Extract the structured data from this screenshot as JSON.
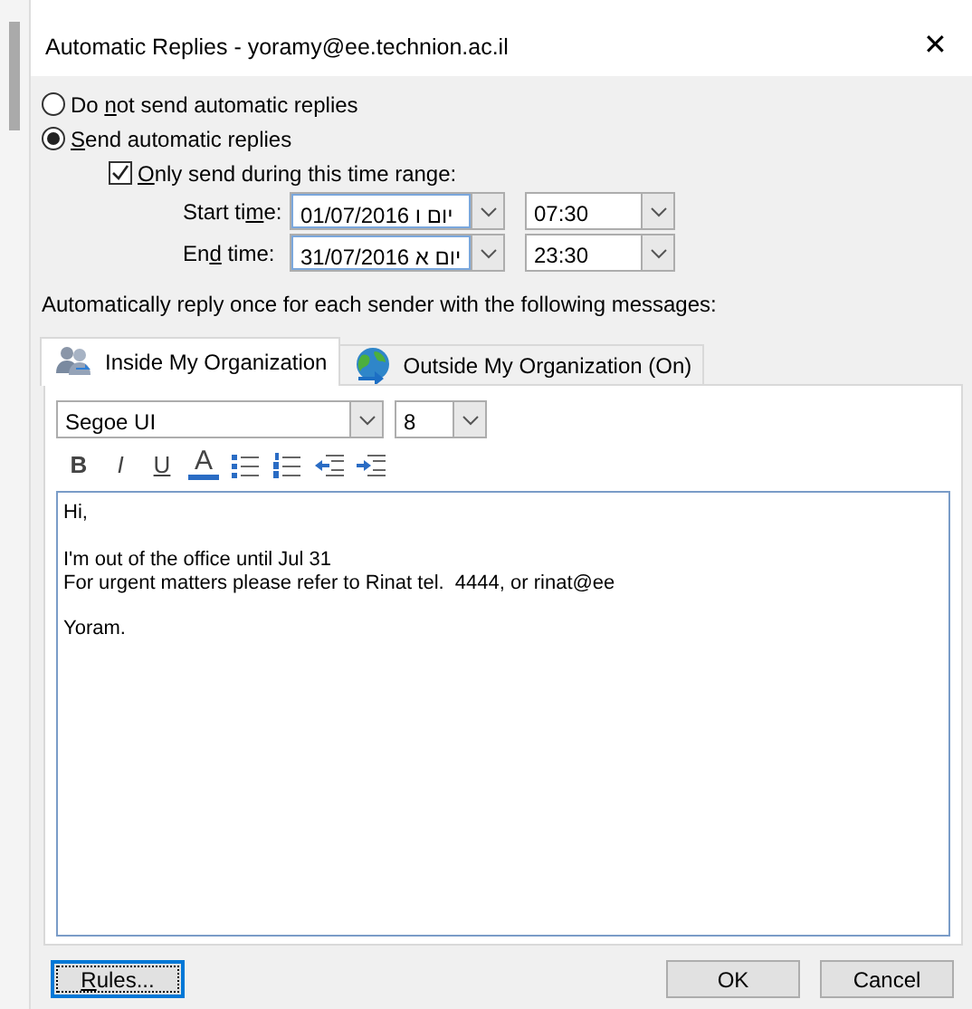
{
  "window": {
    "title": "Automatic Replies - yoramy@ee.technion.ac.il",
    "close": "✕"
  },
  "modes": [
    {
      "label": {
        "pre": "Do ",
        "key": "n",
        "post": "ot send automatic replies"
      },
      "selected": false
    },
    {
      "label": {
        "key": "S",
        "post": "end automatic replies"
      },
      "selected": true
    }
  ],
  "time_range": {
    "label": {
      "key": "O",
      "post": "nly send during this time range:"
    },
    "checked": true
  },
  "times": [
    {
      "label": {
        "pre": "Start ti",
        "key": "m",
        "post": "e:"
      },
      "date": "01/07/2016 יום ו",
      "time": "07:30"
    },
    {
      "label": {
        "pre": "En",
        "key": "d",
        "post": " time:"
      },
      "date": "31/07/2016 יום א",
      "time": "23:30"
    }
  ],
  "messages_label": "Automatically reply once for each sender with the following messages:",
  "tabs": [
    {
      "label": "Inside My Organization",
      "kind": "people",
      "selected": true
    },
    {
      "label": "Outside My Organization (On)",
      "kind": "globe",
      "selected": false
    }
  ],
  "font": {
    "family": "Segoe UI",
    "size": "8"
  },
  "toolbar": [
    {
      "kind": "bold",
      "label": "B"
    },
    {
      "kind": "italic",
      "label": "I"
    },
    {
      "kind": "underline",
      "label": "U"
    },
    {
      "kind": "font-color",
      "label": "A"
    },
    {
      "kind": "bullets"
    },
    {
      "kind": "numbering"
    },
    {
      "kind": "outdent"
    },
    {
      "kind": "indent"
    }
  ],
  "message": "Hi,\n\nI'm out of the office until Jul 31\nFor urgent matters please refer to Rinat tel.  4444, or rinat@ee\n\nYoram.",
  "buttons": [
    {
      "label": {
        "key": "R",
        "post": "ules..."
      },
      "kind": "rules"
    },
    {
      "label": {
        "pre": "OK"
      },
      "kind": "ok"
    },
    {
      "label": {
        "pre": "Cancel"
      },
      "kind": "cancel"
    }
  ]
}
